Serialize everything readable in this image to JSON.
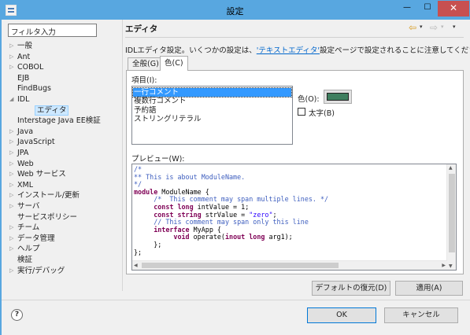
{
  "window": {
    "title": "設定",
    "min_glyph": "—",
    "max_glyph": "☐",
    "close_glyph": "✕"
  },
  "filter": {
    "value": "フィルタ入力"
  },
  "tree": [
    {
      "label": "一般",
      "arrow": "▷"
    },
    {
      "label": "Ant",
      "arrow": "▷"
    },
    {
      "label": "COBOL",
      "arrow": "▷"
    },
    {
      "label": "EJB",
      "arrow": ""
    },
    {
      "label": "FindBugs",
      "arrow": ""
    },
    {
      "label": "IDL",
      "arrow": "◢"
    },
    {
      "label": "エディタ",
      "arrow": "",
      "child": true,
      "selected": true
    },
    {
      "label": "Interstage Java EE検証",
      "arrow": ""
    },
    {
      "label": "Java",
      "arrow": "▷"
    },
    {
      "label": "JavaScript",
      "arrow": "▷"
    },
    {
      "label": "JPA",
      "arrow": "▷"
    },
    {
      "label": "Web",
      "arrow": "▷"
    },
    {
      "label": "Web サービス",
      "arrow": "▷"
    },
    {
      "label": "XML",
      "arrow": "▷"
    },
    {
      "label": "インストール/更新",
      "arrow": "▷"
    },
    {
      "label": "サーバ",
      "arrow": "▷"
    },
    {
      "label": "サービスポリシー",
      "arrow": ""
    },
    {
      "label": "チーム",
      "arrow": "▷"
    },
    {
      "label": "データ管理",
      "arrow": "▷"
    },
    {
      "label": "ヘルプ",
      "arrow": "▷"
    },
    {
      "label": "検証",
      "arrow": ""
    },
    {
      "label": "実行/デバッグ",
      "arrow": "▷"
    }
  ],
  "page": {
    "title": "エディタ",
    "description_before": "IDLエディタ設定。いくつかの設定は、",
    "description_link": "'テキストエディタ'",
    "description_after": "設定ページで設定されることに注意してください。",
    "nav": {
      "back": "⇦",
      "forward": "⇨",
      "dropdown": "▾"
    }
  },
  "tabs": [
    {
      "label": "全般(G)",
      "active": false
    },
    {
      "label": "色(C)",
      "active": true
    }
  ],
  "items": {
    "label": "項目(I):",
    "entries": [
      "一行コメント",
      "複数行コメント",
      "予約語",
      "ストリングリテラル"
    ],
    "selected_index": 0
  },
  "color": {
    "label": "色(O):",
    "value": "#3f7f5f",
    "bold_label": "太字(B)",
    "bold_checked": false
  },
  "preview": {
    "label": "プレビュー(W):",
    "lines": [
      [
        {
          "t": "/*",
          "s": "comment"
        }
      ],
      [
        {
          "t": "** This is about ModuleName.",
          "s": "comment"
        }
      ],
      [
        {
          "t": "*/",
          "s": "comment"
        }
      ],
      [
        {
          "t": "module",
          "s": "kw"
        },
        {
          "t": " ModuleName {",
          "s": "plain"
        }
      ],
      [
        {
          "t": "     /*  This comment may span multiple lines. */",
          "s": "comment"
        }
      ],
      [
        {
          "t": "     ",
          "s": "plain"
        },
        {
          "t": "const long",
          "s": "kw"
        },
        {
          "t": " intValue = 1;",
          "s": "plain"
        }
      ],
      [
        {
          "t": "     ",
          "s": "plain"
        },
        {
          "t": "const string",
          "s": "kw"
        },
        {
          "t": " strValue = ",
          "s": "plain"
        },
        {
          "t": "\"zero\"",
          "s": "str"
        },
        {
          "t": ";",
          "s": "plain"
        }
      ],
      [
        {
          "t": "     // This comment may span only this line",
          "s": "comment"
        }
      ],
      [
        {
          "t": "     ",
          "s": "plain"
        },
        {
          "t": "interface",
          "s": "kw"
        },
        {
          "t": " MyApp {",
          "s": "plain"
        }
      ],
      [
        {
          "t": "          ",
          "s": "plain"
        },
        {
          "t": "void",
          "s": "kw"
        },
        {
          "t": " operate(",
          "s": "plain"
        },
        {
          "t": "inout long",
          "s": "kw"
        },
        {
          "t": " arg1);",
          "s": "plain"
        }
      ],
      [
        {
          "t": "     };",
          "s": "plain"
        }
      ],
      [
        {
          "t": "};",
          "s": "plain"
        }
      ]
    ]
  },
  "buttons": {
    "restore_defaults": "デフォルトの復元(D)",
    "apply": "適用(A)",
    "ok": "OK",
    "cancel": "キャンセル",
    "help": "?"
  }
}
